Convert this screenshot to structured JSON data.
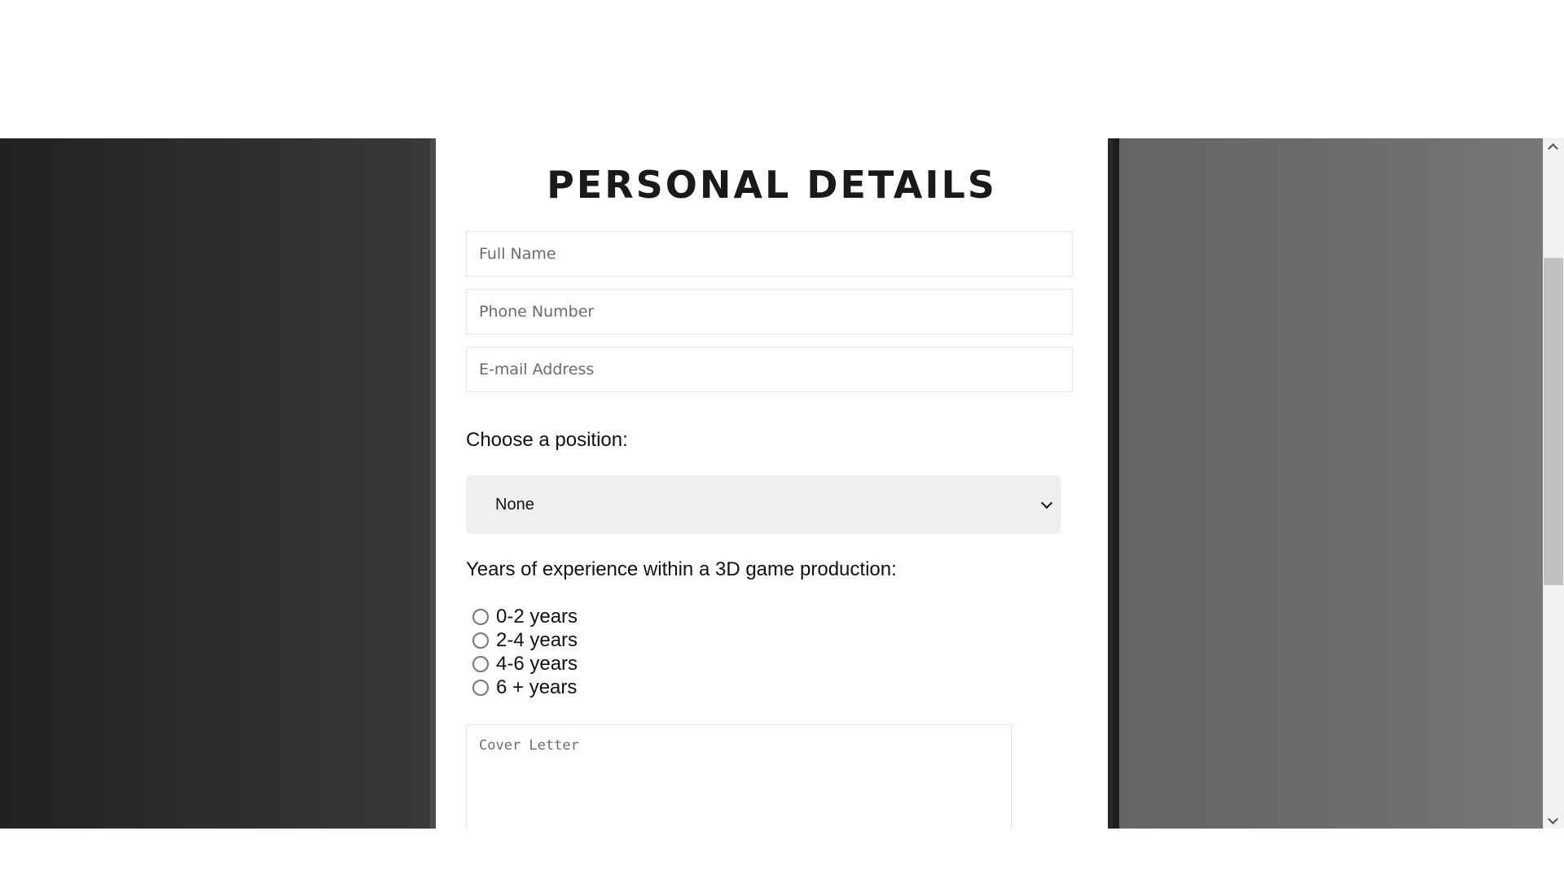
{
  "form": {
    "title": "PERSONAL DETAILS",
    "full_name_placeholder": "Full Name",
    "phone_placeholder": "Phone Number",
    "email_placeholder": "E-mail Address",
    "position_label": "Choose a position:",
    "position_selected": "None",
    "experience_label": "Years of experience within a 3D game production:",
    "experience_options": [
      "0-2 years",
      "2-4 years",
      "4-6 years",
      "6 + years"
    ],
    "cover_letter_placeholder": "Cover Letter"
  },
  "icons": {
    "select_chevron": "chevron-down-icon",
    "scroll_up": "chevron-up-icon",
    "scroll_down": "chevron-down-icon"
  },
  "colors": {
    "left_background": "#2b2b2b",
    "right_background": "#6b6b6b",
    "select_background": "#efefef",
    "title_color": "#1a1a1a"
  }
}
